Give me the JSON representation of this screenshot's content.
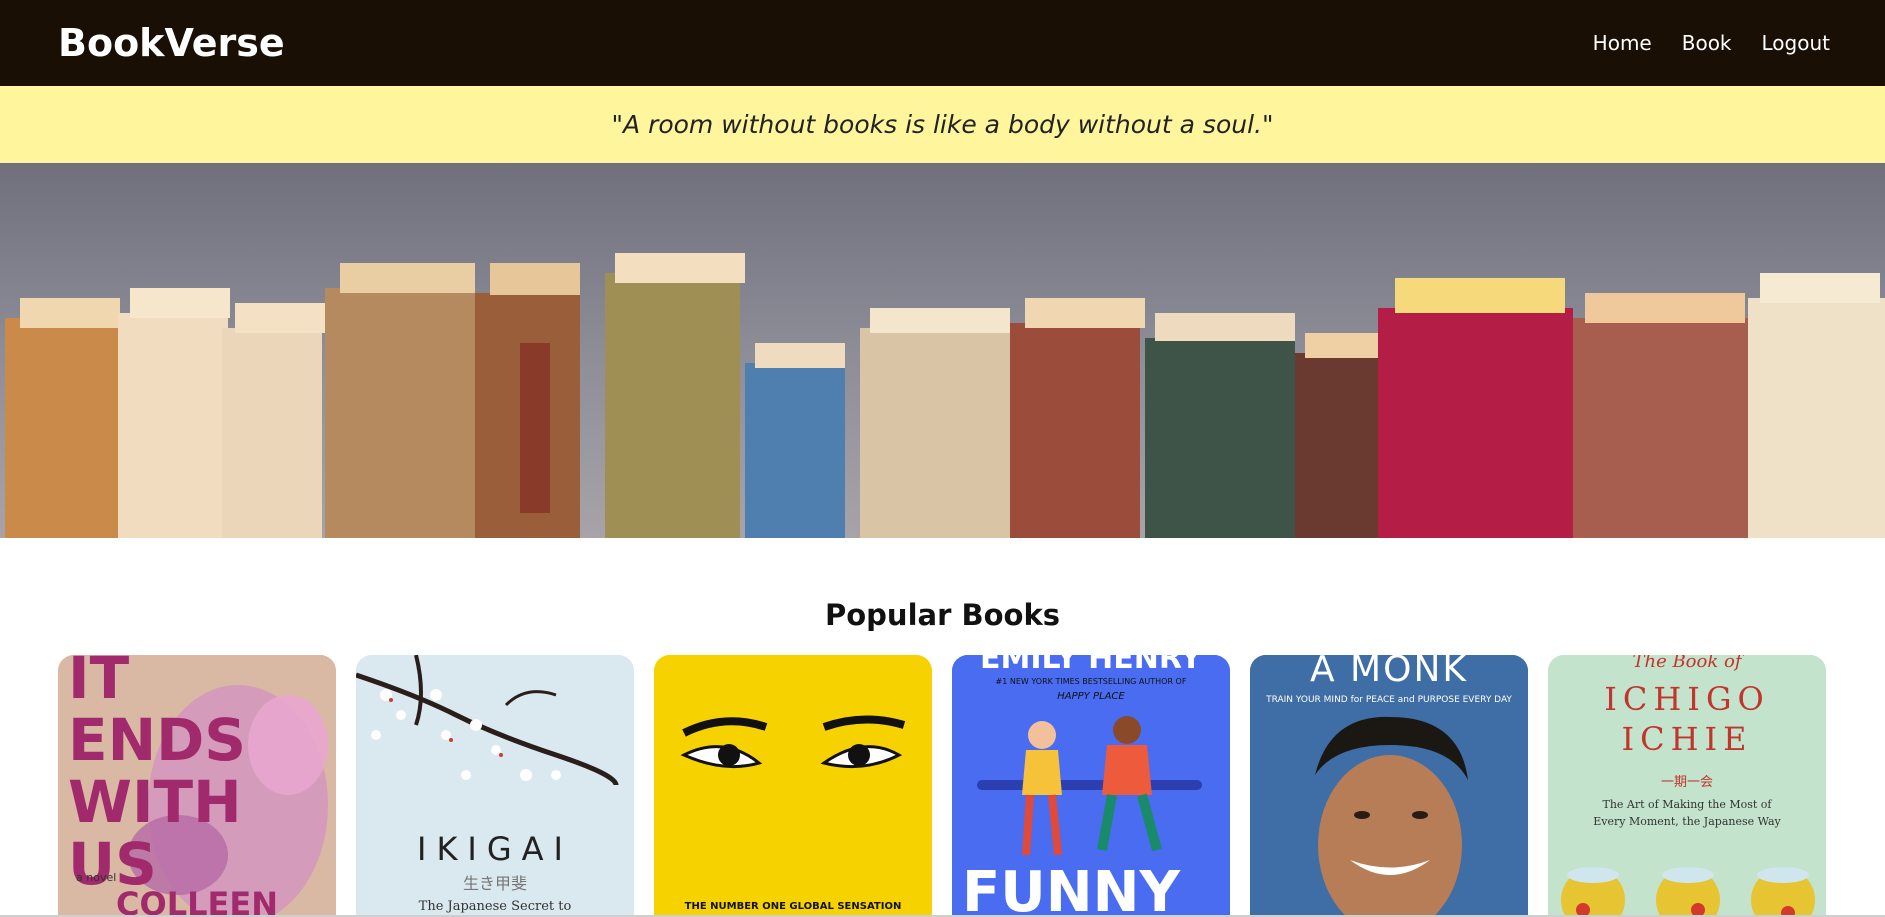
{
  "header": {
    "brand": "BookVerse",
    "nav": [
      {
        "label": "Home"
      },
      {
        "label": "Book"
      },
      {
        "label": "Logout"
      }
    ]
  },
  "quote": "\"A room without books is like a body without a soul.\"",
  "popular": {
    "title": "Popular Books",
    "books": [
      {
        "cover_text": "IT ENDS WITH US",
        "tag": "a novel",
        "author": "COLLEEN",
        "color": "#d7b7a0"
      },
      {
        "cover_text": "IKIGAI",
        "subtitle_jp": "生き甲斐",
        "tagline": "The Japanese Secret to",
        "color": "#dbe8ef"
      },
      {
        "cover_text": "THE NUMBER ONE GLOBAL SENSATION",
        "color": "#f7d000"
      },
      {
        "author": "EMILY HENRY",
        "line": "#1 NEW YORK TIMES BESTSELLING AUTHOR OF",
        "prev": "HAPPY PLACE",
        "cover_text": "FUNNY",
        "color": "#4a6cf0"
      },
      {
        "cover_text": "A MONK",
        "tagline": "TRAIN YOUR MIND for PEACE and PURPOSE EVERY DAY",
        "color": "#3f6da6"
      },
      {
        "pretitle": "The Book of",
        "cover_text": "ICHIGO ICHIE",
        "subtitle_jp": "一期一会",
        "tagline1": "The Art of Making the Most of",
        "tagline2": "Every Moment, the Japanese Way",
        "color": "#c4e3cd"
      }
    ]
  }
}
